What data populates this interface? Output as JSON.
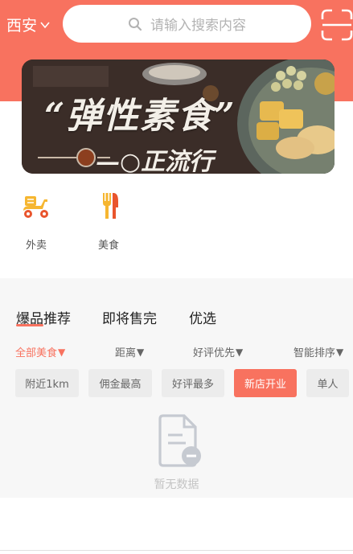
{
  "header": {
    "city": "西安",
    "search_placeholder": "请输入搜索内容",
    "accent_color": "#f8725f"
  },
  "banner": {
    "headline": "“弹性素食”",
    "subline": "—○正流行"
  },
  "categories": [
    {
      "label": "外卖",
      "icon": "scooter-icon"
    },
    {
      "label": "美食",
      "icon": "fork-knife-icon"
    }
  ],
  "tabs": [
    {
      "label": "爆品推荐",
      "active": true
    },
    {
      "label": "即将售完",
      "active": false
    },
    {
      "label": "优选",
      "active": false
    }
  ],
  "sort_options": [
    {
      "label": "全部美食",
      "arrow": "▼",
      "active": true
    },
    {
      "label": "距离",
      "arrow": "▼",
      "active": false
    },
    {
      "label": "好评优先",
      "arrow": "▼",
      "active": false
    },
    {
      "label": "智能排序",
      "arrow": "▼",
      "active": false
    }
  ],
  "filter_chips": [
    {
      "label": "附近1km",
      "active": false
    },
    {
      "label": "佣金最高",
      "active": false
    },
    {
      "label": "好评最多",
      "active": false
    },
    {
      "label": "新店开业",
      "active": true
    },
    {
      "label": "单人",
      "active": false
    }
  ],
  "empty_state": {
    "text": "暂无数据",
    "icon": "no-data-document-icon"
  }
}
